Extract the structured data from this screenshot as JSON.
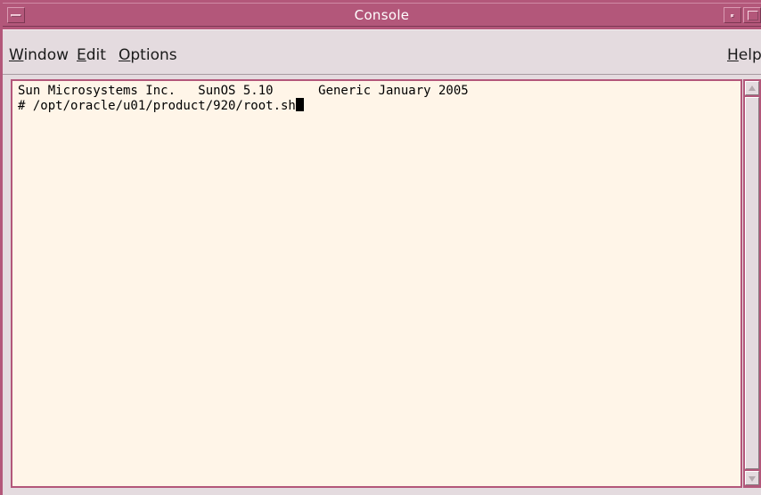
{
  "window": {
    "title": "Console"
  },
  "menubar": {
    "items": [
      {
        "mnemonic": "W",
        "rest": "indow"
      },
      {
        "mnemonic": "E",
        "rest": "dit"
      },
      {
        "mnemonic": "O",
        "rest": "ptions"
      }
    ],
    "help": {
      "mnemonic": "H",
      "rest": "elp"
    }
  },
  "terminal": {
    "line1": "Sun Microsystems Inc.   SunOS 5.10      Generic January 2005",
    "line2": "# /opt/oracle/u01/product/920/root.sh"
  },
  "colors": {
    "frame": "#b3577a",
    "terminal_bg": "#fff5e8",
    "menu_bg": "#e4dbdf"
  },
  "icons": {
    "window_menu": "window-menu-icon",
    "minimize": "minimize-icon",
    "maximize": "maximize-icon",
    "scroll_up": "arrow-up-icon",
    "scroll_down": "arrow-down-icon"
  }
}
